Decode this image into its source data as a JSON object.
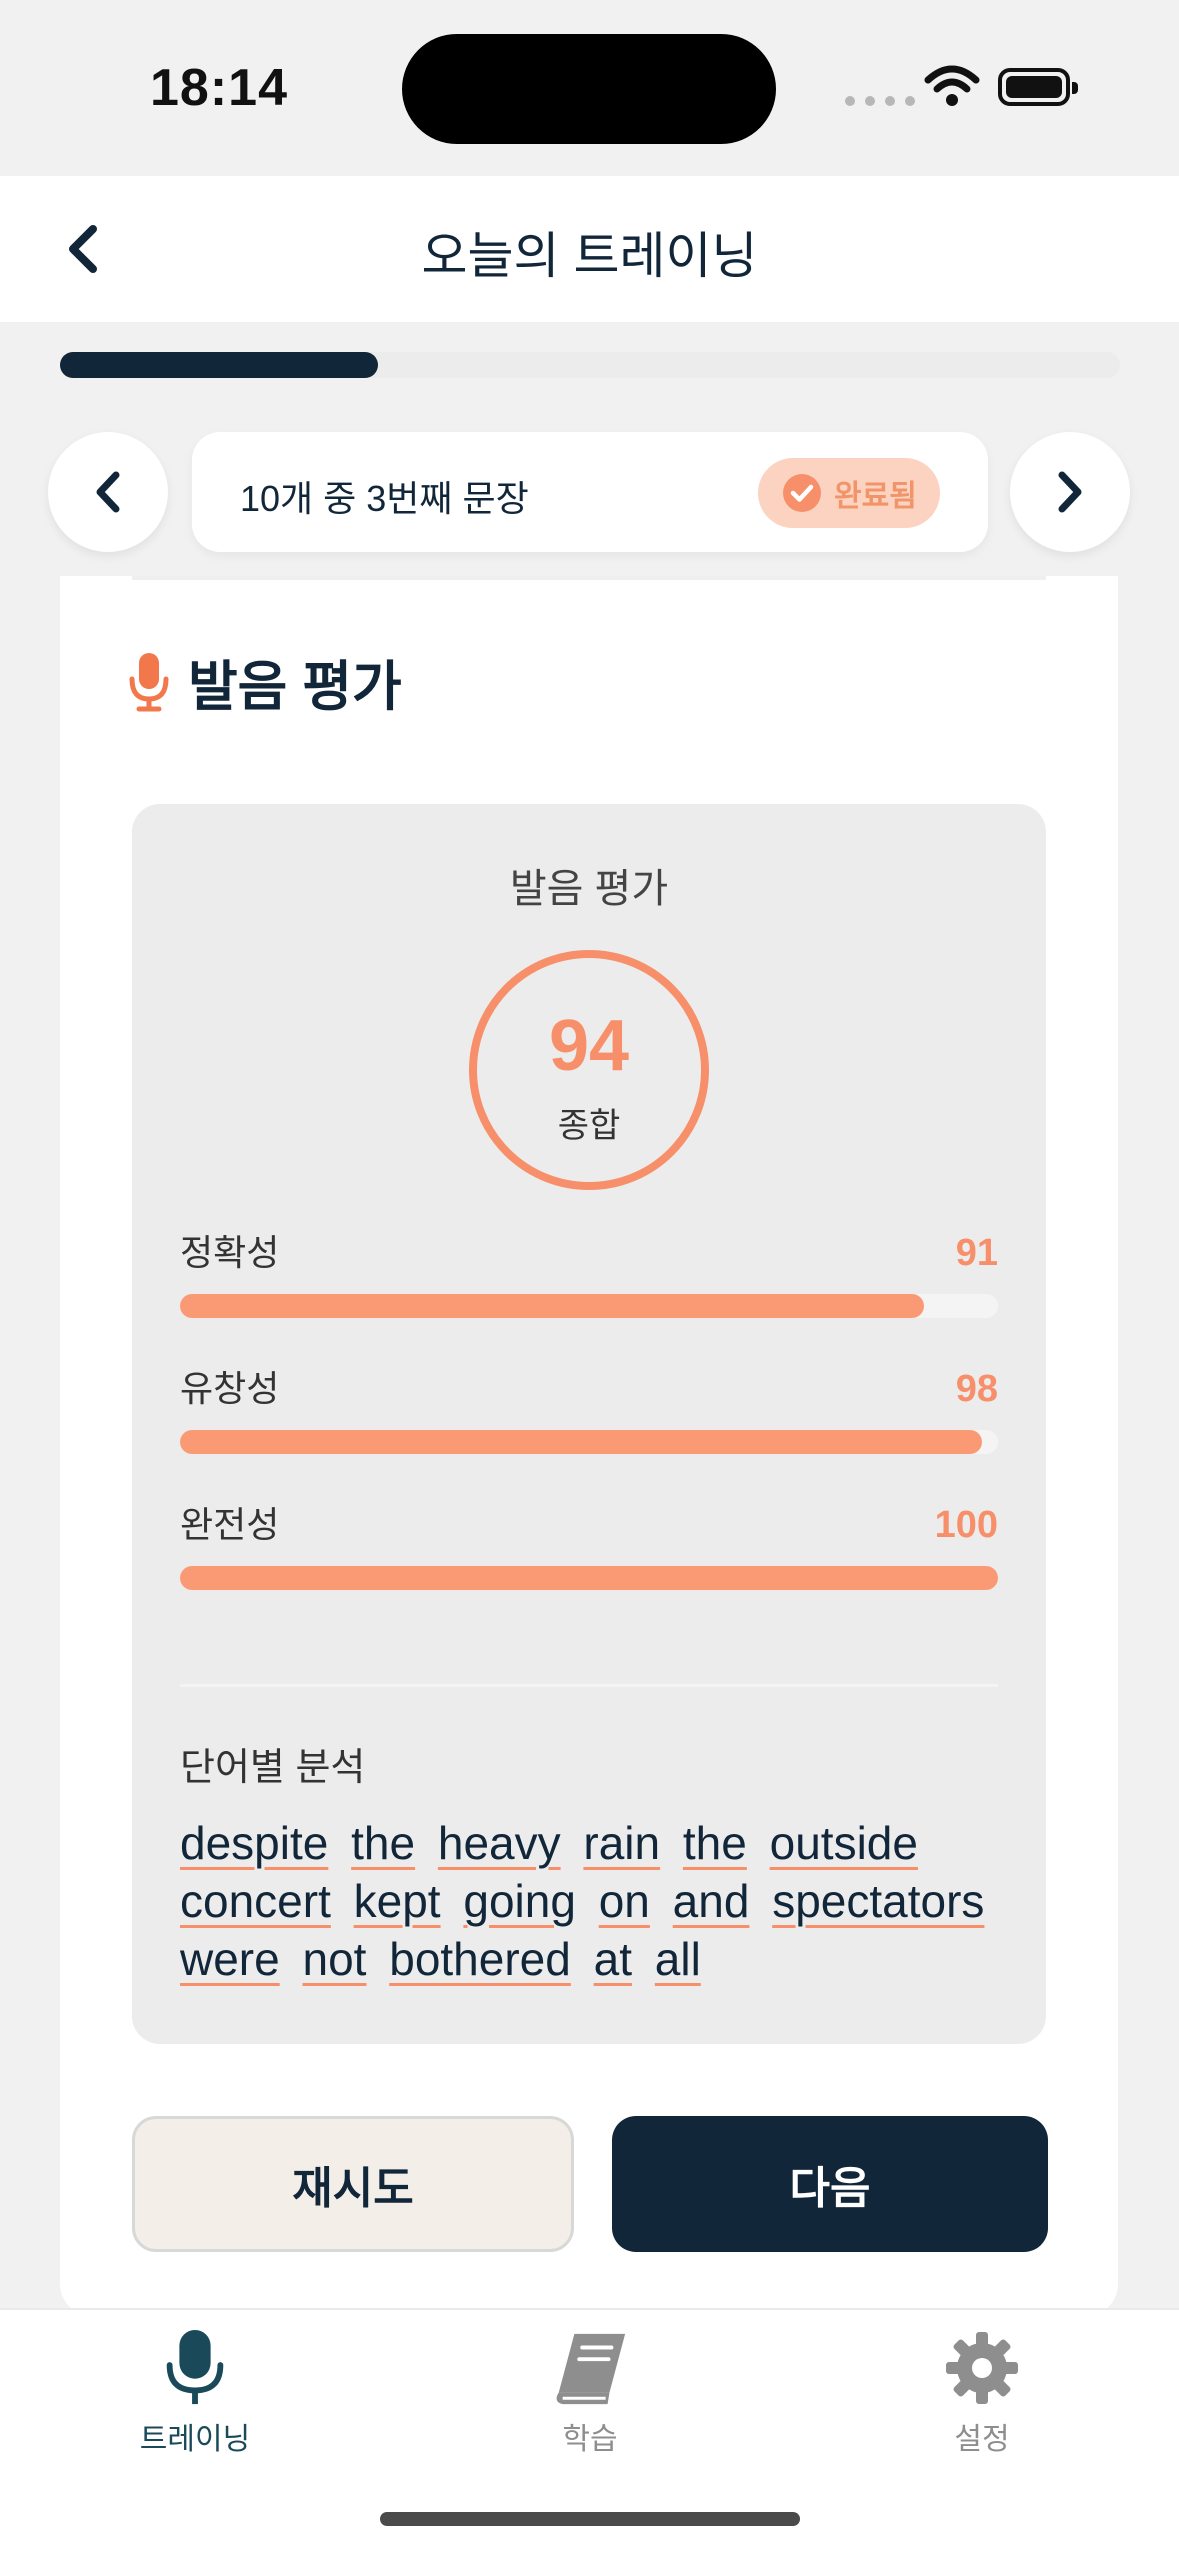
{
  "status_bar": {
    "time": "18:14"
  },
  "header": {
    "title": "오늘의 트레이닝"
  },
  "progress": {
    "fraction": 0.3
  },
  "sentence_nav": {
    "position_text": "10개 중 3번째 문장",
    "badge": "완료됨"
  },
  "section": {
    "title": "발음 평가"
  },
  "evaluation": {
    "panel_title": "발음 평가",
    "overall_score": "94",
    "overall_label": "종합",
    "metrics": [
      {
        "label": "정확성",
        "value": "91",
        "fraction": 0.91
      },
      {
        "label": "유창성",
        "value": "98",
        "fraction": 0.98
      },
      {
        "label": "완전성",
        "value": "100",
        "fraction": 1.0
      }
    ],
    "word_analysis_title": "단어별 분석",
    "words": [
      "despite",
      "the",
      "heavy",
      "rain",
      "the",
      "outside",
      "concert",
      "kept",
      "going",
      "on",
      "and",
      "spectators",
      "were",
      "not",
      "bothered",
      "at",
      "all"
    ]
  },
  "actions": {
    "retry": "재시도",
    "next": "다음"
  },
  "tab_bar": {
    "items": [
      {
        "label": "트레이닝",
        "icon": "microphone-icon",
        "active": true
      },
      {
        "label": "학습",
        "icon": "book-icon",
        "active": false
      },
      {
        "label": "설정",
        "icon": "gear-icon",
        "active": false
      }
    ]
  },
  "colors": {
    "navy": "#12263a",
    "accent": "#f7906a",
    "badge_bg": "#fcd3c1",
    "teal": "#1a4a5a"
  }
}
